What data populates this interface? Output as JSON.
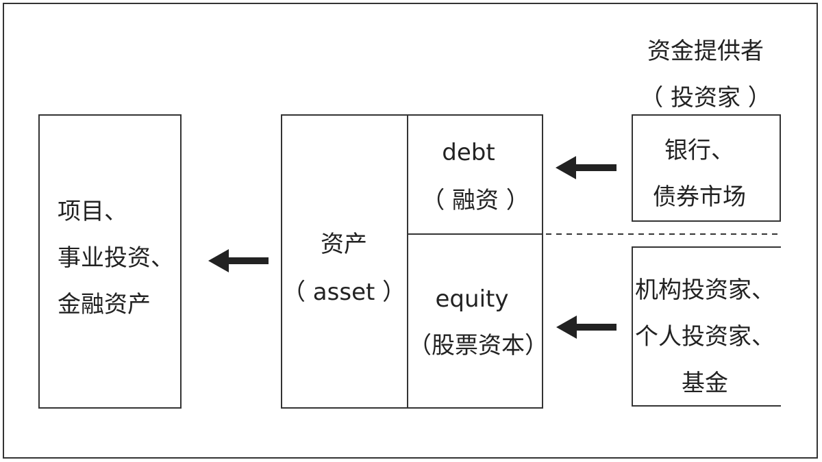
{
  "investor_heading": {
    "line1": "资金提供者",
    "line2": "（ 投资家 ）"
  },
  "project_box": {
    "line1": "项目、",
    "line2": "事业投资、",
    "line3": "金融资产"
  },
  "asset": {
    "label": "资产",
    "label_en": "（ asset ）"
  },
  "debt": {
    "label_en": "debt",
    "label": "（ 融资 ）"
  },
  "equity": {
    "label_en": "equity",
    "label": "（股票资本）"
  },
  "bank_box": {
    "line1": "银行、",
    "line2": "债券市场"
  },
  "institution_box": {
    "line1": "机构投资家、",
    "line2": "个人投资家、",
    "line3": "基金"
  }
}
